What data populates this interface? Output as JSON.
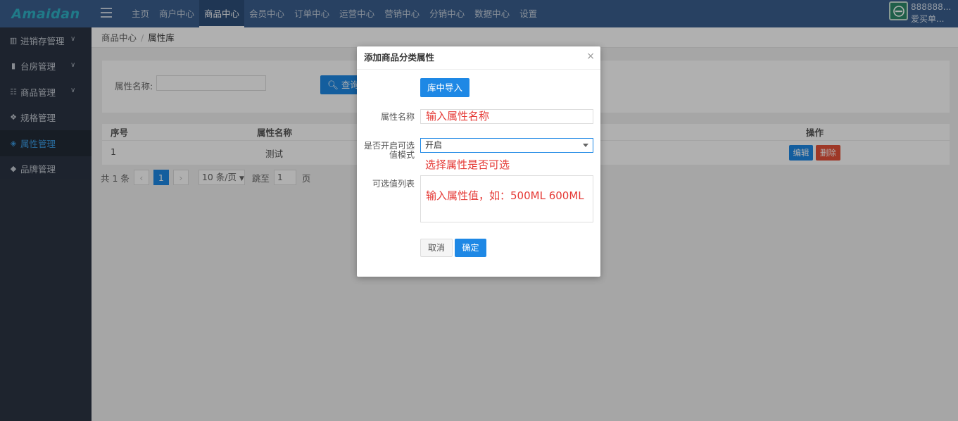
{
  "header": {
    "logo": "Amaidan",
    "nav": [
      "主页",
      "商户中心",
      "商品中心",
      "会员中心",
      "订单中心",
      "运营中心",
      "营销中心",
      "分销中心",
      "数据中心",
      "设置"
    ],
    "active_nav": "商品中心",
    "user": {
      "line1": "888888...",
      "line2": "爱买单..."
    }
  },
  "sidebar": {
    "items": [
      {
        "label": "进销存管理",
        "icon": "map-icon",
        "chevron": true
      },
      {
        "label": "台房管理",
        "icon": "bookmark-icon",
        "chevron": true
      },
      {
        "label": "商品管理",
        "icon": "grid-icon",
        "chevron": true
      },
      {
        "label": "规格管理",
        "icon": "cubes-icon",
        "chevron": false
      },
      {
        "label": "属性管理",
        "icon": "cube-icon",
        "chevron": false,
        "active": true
      },
      {
        "label": "品牌管理",
        "icon": "tags-icon",
        "chevron": false
      }
    ]
  },
  "breadcrumb": {
    "home": "商品中心",
    "current": "属性库"
  },
  "search": {
    "label": "属性名称:",
    "value": "",
    "button": "查询"
  },
  "table": {
    "headers": {
      "index": "序号",
      "name": "属性名称",
      "op": "操作"
    },
    "rows": [
      {
        "index": "1",
        "name": "测试",
        "edit": "编辑",
        "delete": "删除"
      }
    ]
  },
  "pagination": {
    "total": "共 1 条",
    "prev": "‹",
    "current": "1",
    "next": "›",
    "page_size": "10 条/页",
    "jump_label": "跳至",
    "jump_value": "1",
    "page_suffix": "页"
  },
  "dialog": {
    "title": "添加商品分类属性",
    "close": "×",
    "import_button": "库中导入",
    "name_label": "属性名称",
    "name_value": "输入属性名称",
    "mode_label_line1": "是否开启可选",
    "mode_label_line2": "值模式",
    "mode_value": "开启",
    "mode_hint": "选择属性是否可选",
    "values_label": "可选值列表",
    "values_value": "输入属性值，如：500ML 600ML",
    "cancel": "取消",
    "confirm": "确定"
  }
}
